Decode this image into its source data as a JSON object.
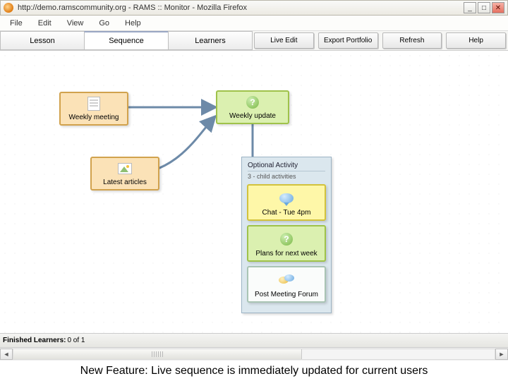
{
  "titlebar": {
    "title": "http://demo.ramscommunity.org - RAMS :: Monitor - Mozilla Firefox"
  },
  "menubar": [
    "File",
    "Edit",
    "View",
    "Go",
    "Help"
  ],
  "tabs": [
    "Lesson",
    "Sequence",
    "Learners"
  ],
  "active_tab_index": 1,
  "toolbar_buttons": [
    "Live Edit",
    "Export Portfolio",
    "Refresh",
    "Help"
  ],
  "nodes": {
    "weekly_meeting": "Weekly meeting",
    "latest_articles": "Latest articles",
    "weekly_update": "Weekly update"
  },
  "optional": {
    "header": "Optional Activity",
    "sub": "3 - child activities",
    "children": [
      "Chat - Tue 4pm",
      "Plans for next week",
      "Post Meeting Forum"
    ]
  },
  "statusbar": {
    "label": "Finished Learners:",
    "value": "0 of 1"
  },
  "caption": "New Feature: Live sequence is immediately updated for current users"
}
